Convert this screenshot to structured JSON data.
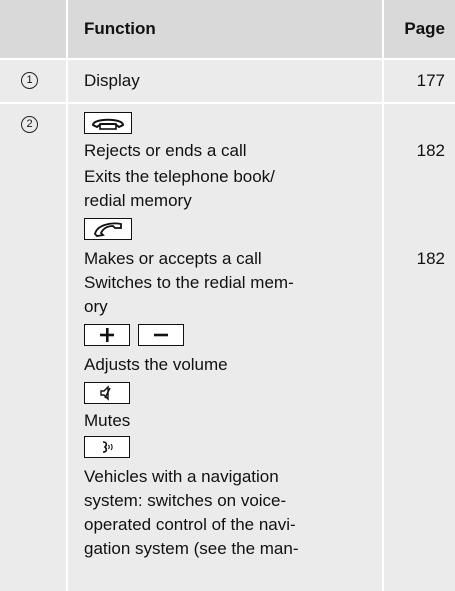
{
  "header": {
    "function": "Function",
    "page": "Page"
  },
  "rows": [
    {
      "number": "1",
      "text": "Display",
      "page": "177"
    },
    {
      "number": "2",
      "lines": [
        "Rejects or ends a call",
        "Exits the telephone book/",
        "redial memory",
        "Makes or accepts a call",
        "Switches to the redial mem-",
        "ory",
        "Adjusts the volume",
        "Mutes",
        "Vehicles with a navigation",
        "system: switches on voice-",
        "operated control of the navi-",
        "gation system (see the man-"
      ],
      "page_a": "182",
      "page_b": "182"
    }
  ],
  "icons": [
    "end-call-icon",
    "accept-call-icon",
    "volume-up-icon",
    "volume-down-icon",
    "mute-icon",
    "voice-control-icon"
  ]
}
